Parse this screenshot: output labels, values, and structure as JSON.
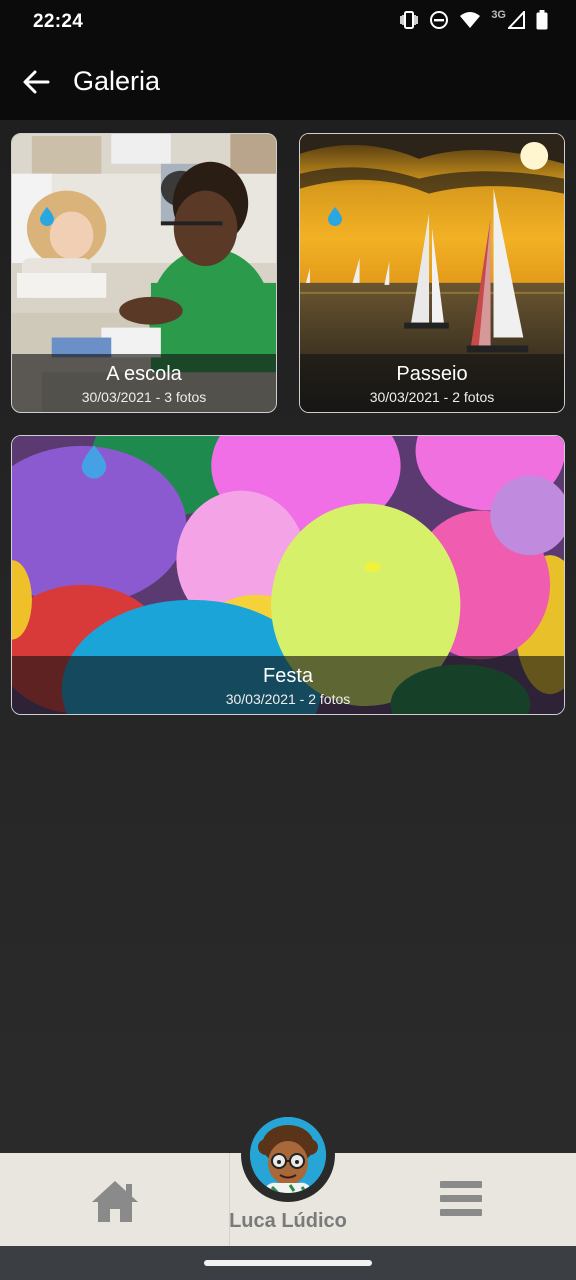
{
  "status_bar": {
    "time": "22:24",
    "network": "3G",
    "icons": [
      "vibrate-icon",
      "do-not-disturb-icon",
      "wifi-icon",
      "signal-icon",
      "battery-icon"
    ]
  },
  "header": {
    "title": "Galeria",
    "back_icon": "arrow-back-icon"
  },
  "albums": [
    {
      "title": "A escola",
      "meta": "30/03/2021 - 3 fotos",
      "icon": "water-drop-icon"
    },
    {
      "title": "Passeio",
      "meta": "30/03/2021 - 2 fotos",
      "icon": "water-drop-icon"
    },
    {
      "title": "Festa",
      "meta": "30/03/2021 - 2 fotos",
      "icon": "water-drop-icon"
    }
  ],
  "bottom_nav": {
    "home_icon": "home-icon",
    "menu_icon": "hamburger-menu-icon",
    "profile_name": "Luca Lúdico"
  },
  "colors": {
    "accent": "#2aa6e0",
    "nav_bg": "#e8e6df",
    "nav_icon": "#8a8a8a"
  }
}
